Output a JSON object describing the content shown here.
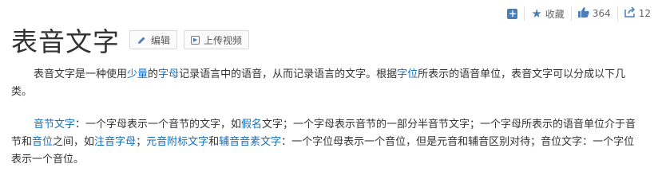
{
  "toolbar": {
    "add_icon": "plus-square-icon",
    "favorite_icon": "star-icon",
    "favorite_label": "收藏",
    "like_icon": "thumbs-up-icon",
    "like_count": "364",
    "share_icon": "share-icon",
    "share_count": "12"
  },
  "title": "表音文字",
  "buttons": {
    "edit_label": "编辑",
    "upload_video_label": "上传视频"
  },
  "paragraph1": {
    "t1": "表音文字是一种使用",
    "link1": "少量",
    "t2": "的",
    "link2": "字母",
    "t3": "记录语言中的语音，从而记录语言的文字。根据",
    "link3": "字位",
    "t4": "所表示的语音单位，表音文字可以分成以下几类。"
  },
  "paragraph2": {
    "link1": "音节文字",
    "t1": "：一个字母表示一个音节的文字，如",
    "link2": "假名",
    "t2": "文字；一个字母表示音节的一部分半音节文字；一个字母所表示的语音单位介于音节和",
    "link3": "音位",
    "t3": "之间，如",
    "link4": "注音字母",
    "t4": "；",
    "link5": "元音附标文字",
    "t5": "和",
    "link6": "辅音音素文字",
    "t6": "：一个字位母表示一个音位，但是元音和辅音区别对待；音位文字：一个字位表示一个音位。"
  },
  "colors": {
    "link": "#136ec2",
    "icon_accent": "#4a7ebb",
    "text": "#333333"
  }
}
